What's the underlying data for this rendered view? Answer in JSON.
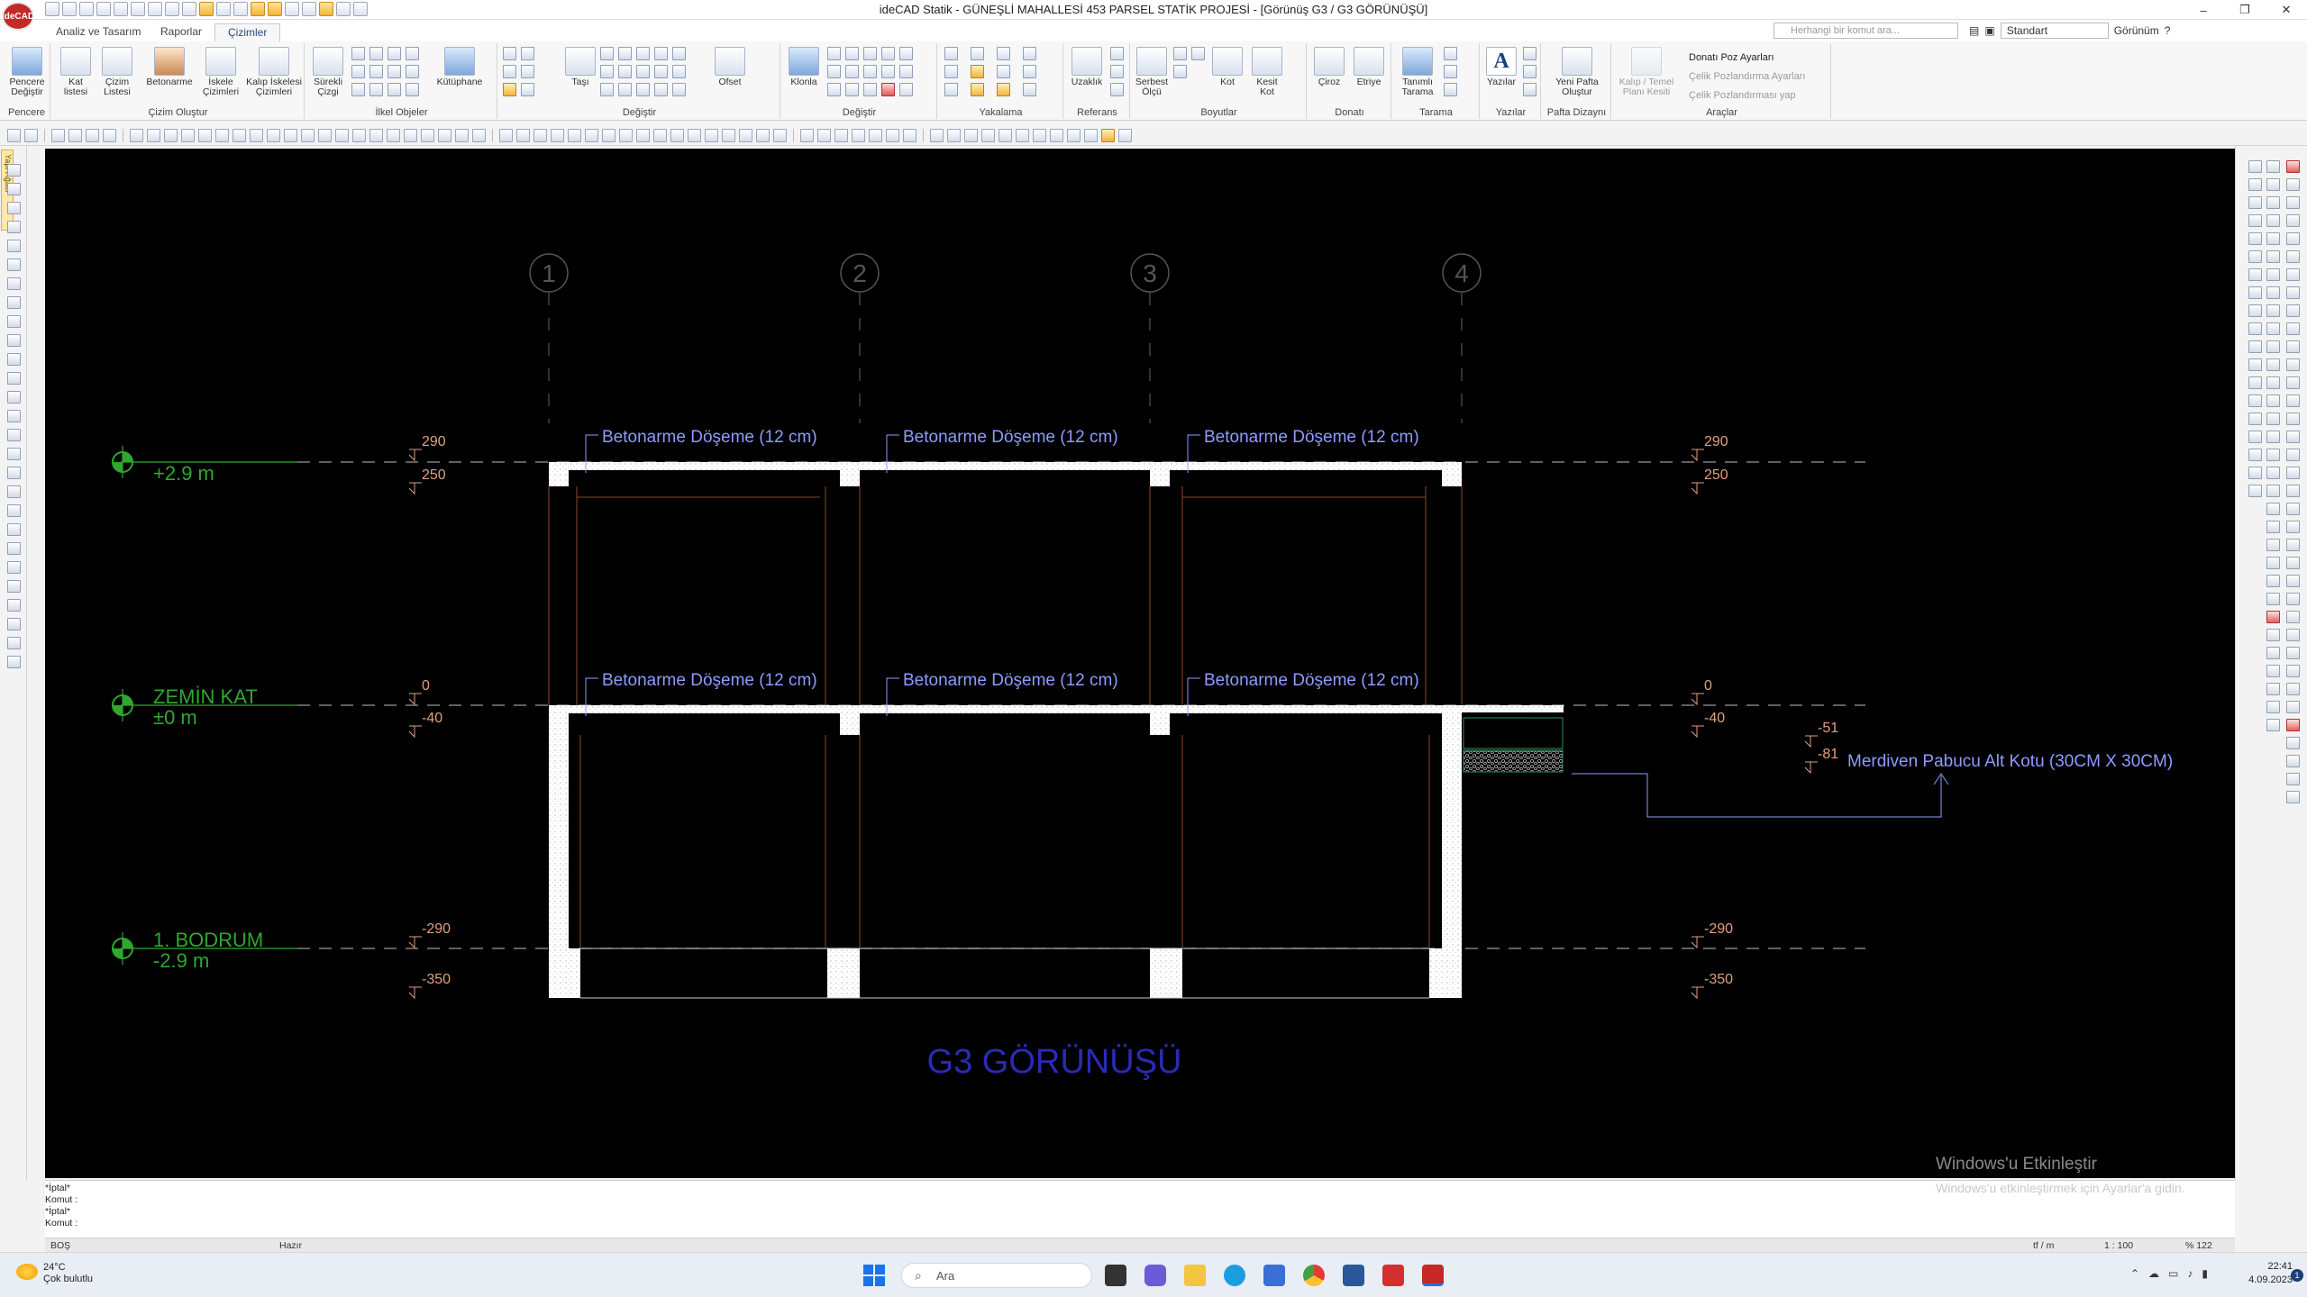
{
  "app": {
    "logo": "ideCAD",
    "title": "ideCAD Statik - GÜNEŞLİ MAHALLESİ 453 PARSEL STATİK PROJESİ - [Görünüş G3 / G3 GÖRÜNÜŞÜ]",
    "window_controls": [
      "–",
      "❐",
      "✕"
    ]
  },
  "menu_tabs": [
    "Analiz ve Tasarım",
    "Raporlar",
    "Çizimler"
  ],
  "active_tab": "Çizimler",
  "search": {
    "placeholder": "Herhangi bir komut ara..."
  },
  "style_dropdown": "Standart",
  "view_label": "Görünüm",
  "ribbon": {
    "groups": [
      {
        "label": "Pencere",
        "buttons": [
          "Pencere Değiştir"
        ]
      },
      {
        "label": "Çizim Oluştur",
        "buttons": [
          "Kat listesi",
          "Çizim Listesi",
          "Betonarme",
          "İskele Çizimleri",
          "Kalıp İskelesi Çizimleri"
        ]
      },
      {
        "label": "İlkel Objeler",
        "buttons": [
          "Sürekli Çizgi",
          "Kütüphane"
        ]
      },
      {
        "label": "Değiştir",
        "buttons": [
          "Taşı",
          "Ofset"
        ]
      },
      {
        "label": "Değiştir",
        "buttons": [
          "Klonla"
        ]
      },
      {
        "label": "Yakalama",
        "buttons": []
      },
      {
        "label": "Referans",
        "buttons": [
          "Uzaklık"
        ]
      },
      {
        "label": "Boyutlar",
        "buttons": [
          "Serbest Ölçü",
          "Kot",
          "Kesit Kot"
        ]
      },
      {
        "label": "Donatı",
        "buttons": [
          "Çiroz",
          "Etriye"
        ]
      },
      {
        "label": "Tarama",
        "buttons": [
          "Tanımlı Tarama"
        ]
      },
      {
        "label": "Yazılar",
        "buttons": [
          "Yazılar"
        ]
      },
      {
        "label": "Pafta Dizaynı",
        "buttons": [
          "Yeni Pafta Oluştur"
        ]
      },
      {
        "label": "Araçlar",
        "buttons": [
          "Kalıp / Temel Planı Kesiti"
        ]
      }
    ],
    "tools_list": [
      "Donatı Poz Ayarları",
      "Çelik Pozlandırma Ayarları",
      "Çelik Pozlandırması yap"
    ]
  },
  "left_panel_tab": "Yapı Ağacı",
  "drawing": {
    "axes": [
      "1",
      "2",
      "3",
      "4"
    ],
    "levels": [
      {
        "name": "+2.9 m",
        "name2": ""
      },
      {
        "name": "ZEMİN KAT",
        "name2": "±0 m"
      },
      {
        "name": "1. BODRUM",
        "name2": "-2.9 m"
      }
    ],
    "elev_left": [
      "290",
      "250",
      "0",
      "-40",
      "-290",
      "-350"
    ],
    "elev_right": [
      "290",
      "250",
      "0",
      "-40",
      "-290",
      "-350"
    ],
    "elev_stair": [
      "-51",
      "-81"
    ],
    "slab_labels": [
      "Betonarme Döşeme (12 cm)",
      "Betonarme Döşeme (12 cm)",
      "Betonarme Döşeme (12 cm)",
      "Betonarme Döşeme (12 cm)",
      "Betonarme Döşeme (12 cm)",
      "Betonarme Döşeme (12 cm)"
    ],
    "note": "Merdiven Pabucu Alt Kotu (30CM X 30CM)",
    "view_title": "G3 GÖRÜNÜŞÜ",
    "watermark_title": "Windows'u Etkinleştir",
    "watermark_sub": "Windows'u etkinleştirmek için Ayarlar'a gidin.",
    "colors": {
      "background": "#000000",
      "level": "#2fa82f",
      "label": "#8f9bff",
      "title": "#2a2ab8",
      "dim": "#e0a080"
    }
  },
  "command_lines": [
    "*İptal*",
    "Komut :",
    "*İptal*",
    "Komut :"
  ],
  "status": {
    "left": "BOŞ",
    "state": "Hazır",
    "unit": "tf / m",
    "scale": "1 : 100",
    "zoom": "% 122"
  },
  "taskbar": {
    "temp": "24°C",
    "weather": "Çok bulutlu",
    "search_label": "Ara",
    "time": "22:41",
    "date": "4.09.2023",
    "notif_count": "1"
  }
}
